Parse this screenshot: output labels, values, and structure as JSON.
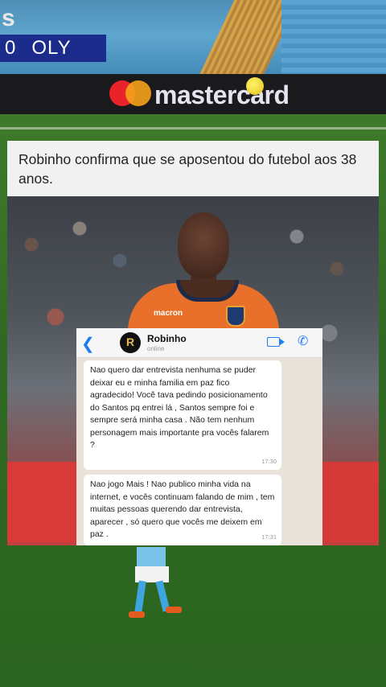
{
  "scoreboard": {
    "score": "0",
    "team": "OLY"
  },
  "adboard": {
    "left_fragment": "s",
    "brand": "mastercard"
  },
  "post": {
    "headline": "Robinho confirma que se aposentou do futebol aos 38 anos."
  },
  "photo": {
    "shirt_sponsor": "macron"
  },
  "chat": {
    "contact_name": "Robinho",
    "contact_status": "online",
    "avatar_letter": "R",
    "messages": [
      {
        "text": "Nao quero dar entrevista nenhuma se puder deixar eu e minha familia em paz fico agradecido! Você tava pedindo posicionamento do Santos pq entrei lá , Santos sempre foi e sempre será minha casa . Não tem nenhum personagem mais importante pra vocês falarem ?",
        "time": "17:30"
      },
      {
        "text": "Nao jogo Mais ! Nao publico minha vida na internet, e vocês continuam falando de mim , tem muitas pessoas querendo dar entrevista, aparecer , só quero que vocês me deixem em paz .",
        "time": "17:31"
      }
    ],
    "icons": {
      "back": "chevron-left-icon",
      "video": "video-call-icon",
      "call": "phone-icon"
    }
  },
  "colors": {
    "score_bug": "#1b2c8c",
    "whatsapp_accent": "#1d7cf2",
    "jersey": "#e8702a"
  }
}
